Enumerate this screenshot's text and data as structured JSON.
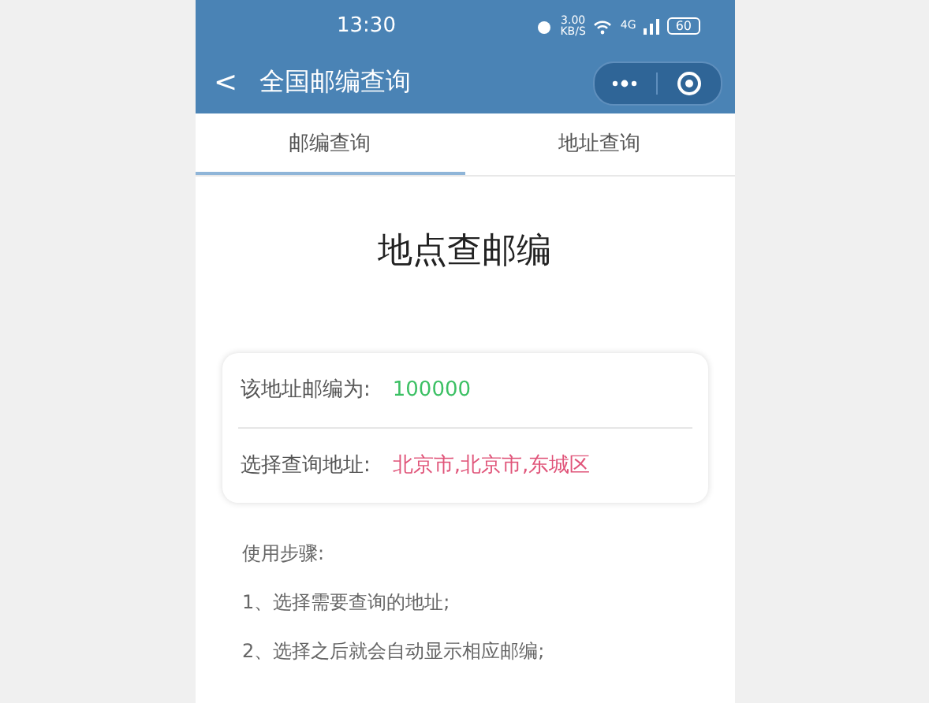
{
  "status_bar": {
    "time": "13:30",
    "speed": "3.00",
    "speed_unit": "KB/S",
    "network": "4G",
    "battery": "60"
  },
  "nav_bar": {
    "back": "<",
    "title": "全国邮编查询"
  },
  "tabs": [
    {
      "label": "邮编查询",
      "selected": true
    },
    {
      "label": "地址查询",
      "selected": false
    }
  ],
  "heading": "地点查邮编",
  "result_card": {
    "rows": [
      {
        "label": "该地址邮编为:",
        "value": "100000",
        "color": "#3cc064"
      },
      {
        "label": "选择查询地址:",
        "value": "北京市,北京市,东城区",
        "color": "#e0557a"
      }
    ]
  },
  "steps": {
    "title": "使用步骤:",
    "items": [
      "1、选择需要查询的地址;",
      "2、选择之后就会自动显示相应邮编;"
    ]
  }
}
